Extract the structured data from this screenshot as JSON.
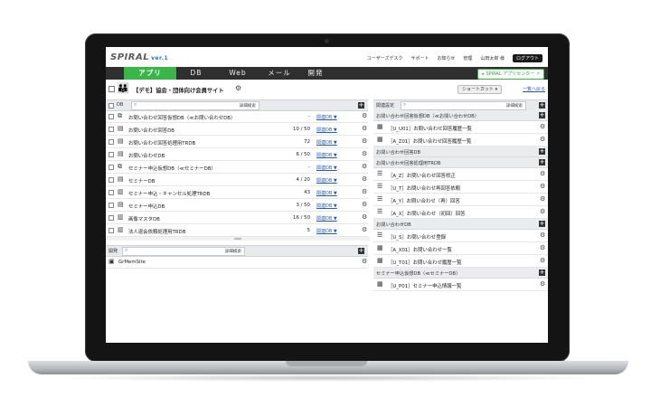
{
  "header": {
    "logo": "SPIRAL",
    "version": "ver.1",
    "links": [
      "ユーザーズデスク",
      "サポート",
      "お知らせ",
      "管理",
      "山田太郎 様"
    ],
    "logout": "ログアウト"
  },
  "nav": {
    "tabs": [
      {
        "label": "アプリ",
        "active": true
      },
      {
        "label": "DB",
        "active": false
      },
      {
        "label": "Web",
        "active": false
      },
      {
        "label": "メール",
        "active": false
      },
      {
        "label": "開発",
        "active": false
      }
    ],
    "app_center": "SPIRAL アプリセンター"
  },
  "title_row": {
    "site_title": "【デモ】協会・団体向け会員サイト",
    "shortcut": "ショートカット",
    "back": "一覧へ戻る"
  },
  "db_panel": {
    "label": "DB",
    "advanced_search": "詳細検索",
    "rows": [
      {
        "name": "お問い合わせ回答仮想DB（≪お問い合わせDB）",
        "count": "-",
        "rel": "関連DB ▼",
        "icon": "virtual-db-icon"
      },
      {
        "name": "お問い合わせ回答DB",
        "count": "10 / 50",
        "rel": "関連DB ▼",
        "icon": "db-icon"
      },
      {
        "name": "お問い合わせ回答処理用TRDB",
        "count": "72",
        "rel": "関連DB ▼",
        "icon": "db-icon"
      },
      {
        "name": "お問い合わせDB",
        "count": "6 / 50",
        "rel": "関連DB ▼",
        "icon": "db-icon"
      },
      {
        "name": "セミナー申込仮想DB（≪セミナーDB）",
        "count": "-",
        "rel": "関連DB ▼",
        "icon": "virtual-db-icon"
      },
      {
        "name": "セミナーDB",
        "count": "4 / 20",
        "rel": "関連DB ▼",
        "icon": "db-icon"
      },
      {
        "name": "セミナー申込・キャンセル処理TRDB",
        "count": "43",
        "rel": "関連DB ▼",
        "icon": "transaction-db-icon"
      },
      {
        "name": "セミナー申込DB",
        "count": "3 / 50",
        "rel": "関連DB ▼",
        "icon": "db-icon"
      },
      {
        "name": "画像マスタDB",
        "count": "16 / 50",
        "rel": "関連DB ▼",
        "icon": "transaction-db-icon"
      },
      {
        "name": "法人退会依頼処理用TRDB",
        "count": "5",
        "rel": "関連DB ▼",
        "icon": "transaction-db-icon"
      }
    ]
  },
  "dev_panel": {
    "label": "開発",
    "advanced_search": "詳細検索",
    "rows": [
      {
        "name": "GrMemSite"
      }
    ]
  },
  "related_panel": {
    "label": "関連設定",
    "advanced_search": "詳細検索",
    "items": [
      {
        "kind": "section",
        "text": "お問い合わせ回答仮想DB（≪お問い合わせDB）"
      },
      {
        "kind": "row",
        "icon": "grid-icon",
        "text": "［U_U01］お問い合わせ回答履歴一覧"
      },
      {
        "kind": "row",
        "icon": "grid-icon",
        "text": "［A_Z01］お問い合わせ回答履歴一覧"
      },
      {
        "kind": "section",
        "text": "お問い合わせ回答DB"
      },
      {
        "kind": "section",
        "text": "お問い合わせ回答処理用TRDB"
      },
      {
        "kind": "row",
        "icon": "list-icon",
        "text": "［A_Z］お問い合わせ回答修正"
      },
      {
        "kind": "row",
        "icon": "list-icon",
        "text": "［U_T］お問い合わせ再回答依頼"
      },
      {
        "kind": "row",
        "icon": "list-icon",
        "text": "［A_Y］お問い合わせ（再）回答"
      },
      {
        "kind": "row",
        "icon": "list-icon",
        "text": "［A_X］お問い合わせ（初回）回答"
      },
      {
        "kind": "section",
        "text": "お問い合わせDB"
      },
      {
        "kind": "row",
        "icon": "list-icon",
        "text": "［U_S］お問い合わせ登録"
      },
      {
        "kind": "row",
        "icon": "grid-icon",
        "text": "［A_X01］お問い合わせ一覧"
      },
      {
        "kind": "row",
        "icon": "grid-icon",
        "text": "［U_T01］お問い合わせ履歴一覧"
      },
      {
        "kind": "section",
        "text": "セミナー申込仮想DB（≪セミナーDB）"
      },
      {
        "kind": "row",
        "icon": "grid-icon",
        "text": "［U_P01］セミナー申込情報一覧"
      }
    ]
  }
}
